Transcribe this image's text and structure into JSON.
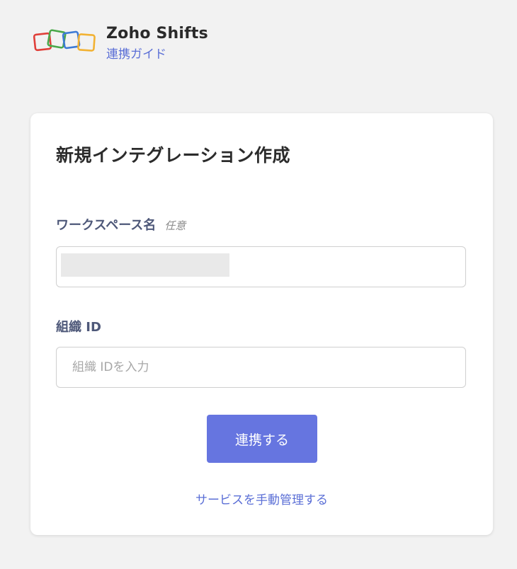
{
  "header": {
    "app_name": "Zoho Shifts",
    "guide_link": "連携ガイド",
    "logo_text": "ZOHO"
  },
  "card": {
    "title": "新規インテグレーション作成",
    "workspace": {
      "label": "ワークスペース名",
      "optional": "任意"
    },
    "org_id": {
      "label": "組織 ID",
      "placeholder": "組織 IDを入力",
      "value": ""
    },
    "connect_button": "連携する",
    "manual_link": "サービスを手動管理する"
  },
  "colors": {
    "accent": "#6675e0",
    "link": "#5b6fd6",
    "logo_red": "#e0403a",
    "logo_green": "#4aa84a",
    "logo_blue": "#3c7ad6",
    "logo_yellow": "#f2b233"
  }
}
